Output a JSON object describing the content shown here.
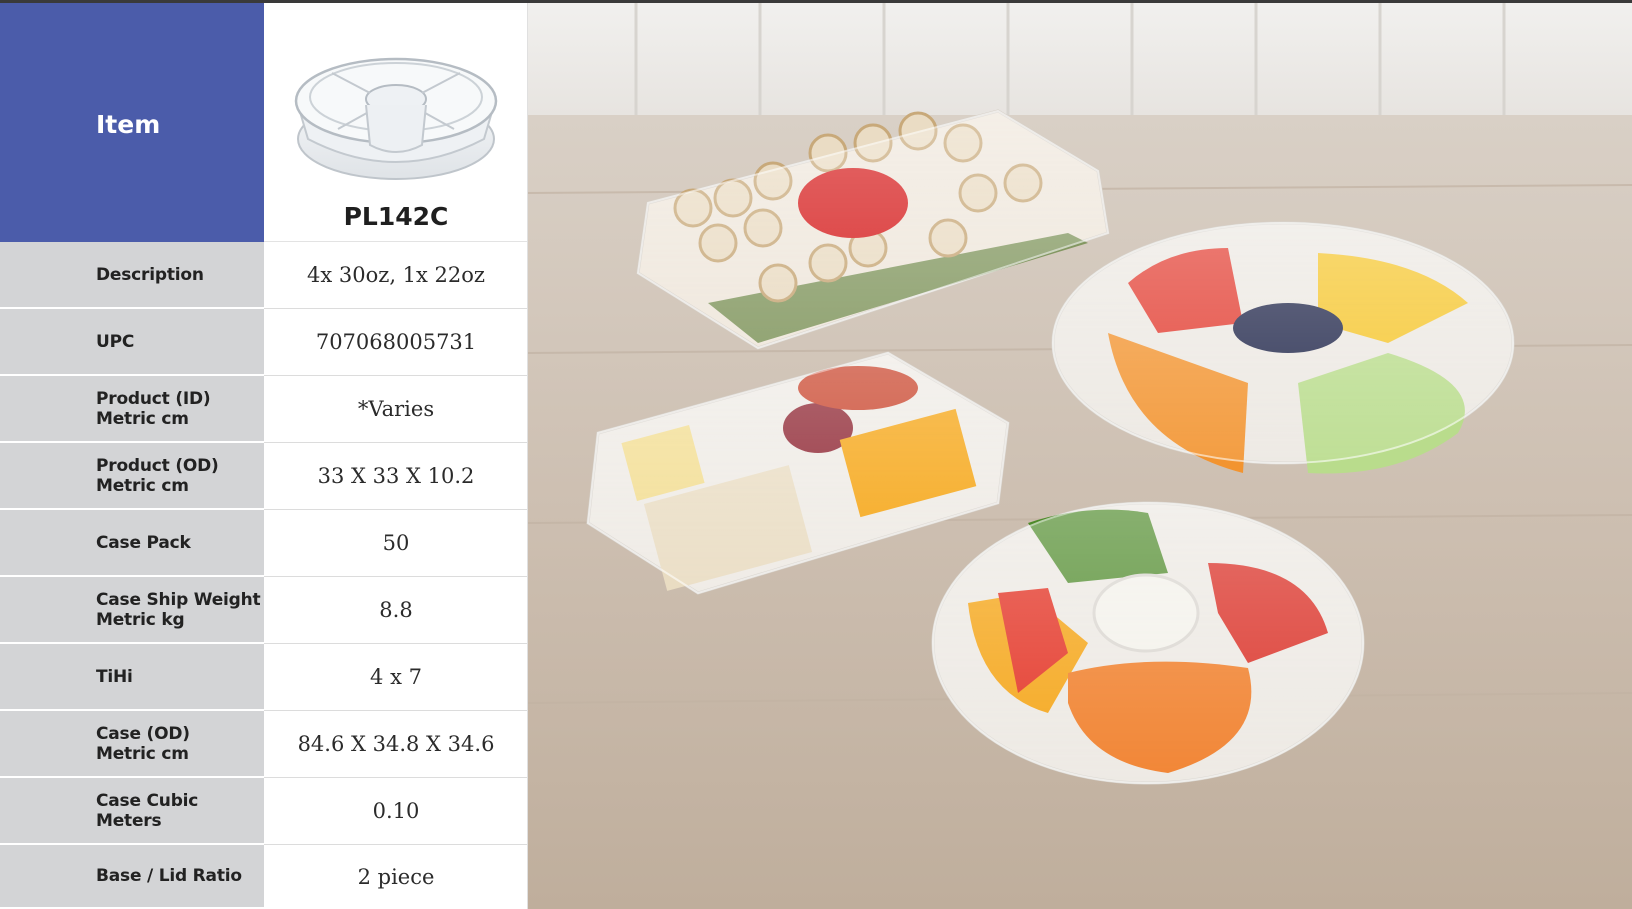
{
  "header": {
    "item_label": "Item",
    "product_code": "PL142C"
  },
  "specs": [
    {
      "label": "Description",
      "value": "4x 30oz, 1x 22oz"
    },
    {
      "label": "UPC",
      "value": "707068005731"
    },
    {
      "label": "Product (ID)\nMetric cm",
      "value": "*Varies"
    },
    {
      "label": "Product (OD)\nMetric cm",
      "value": "33 X 33 X 10.2"
    },
    {
      "label": "Case Pack",
      "value": "50"
    },
    {
      "label": "Case Ship Weight\nMetric kg",
      "value": "8.8"
    },
    {
      "label": "TiHi",
      "value": "4 x 7"
    },
    {
      "label": "Case (OD)\nMetric cm",
      "value": "84.6 X 34.8 X 34.6"
    },
    {
      "label": "Case Cubic Meters",
      "value": "0.10"
    },
    {
      "label": "Base / Lid Ratio",
      "value": "2 piece"
    }
  ],
  "colors": {
    "header_blue": "#4b5caa",
    "label_gray": "#d3d4d6"
  },
  "icons": {
    "product_image": "clear-round-5-compartment-tray",
    "photo": "food-platters-on-wood-table"
  }
}
